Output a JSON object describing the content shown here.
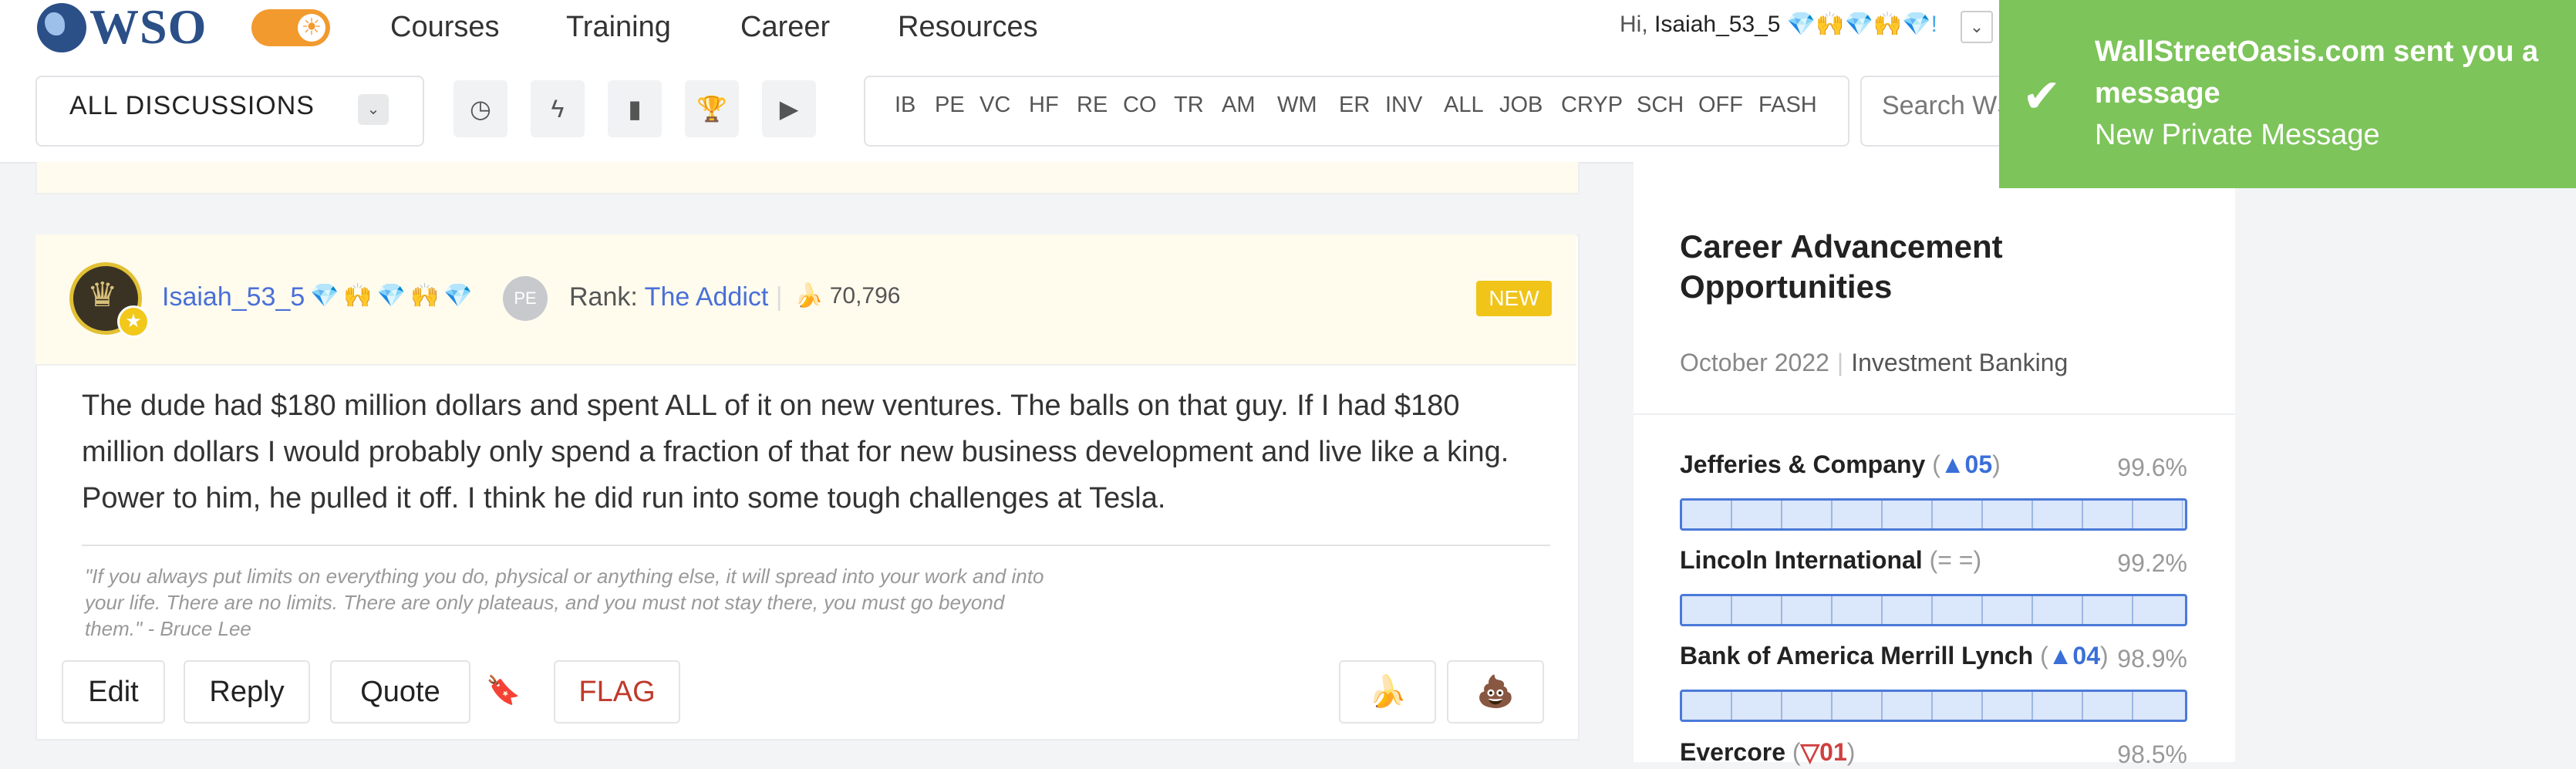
{
  "header": {
    "logo_text": "WSO",
    "nav": [
      "Courses",
      "Training",
      "Career",
      "Resources"
    ],
    "greeting_prefix": "Hi,",
    "greeting_user": "Isaiah_53_5",
    "greeting_emoji": "💎🙌💎🙌💎!"
  },
  "toolbar": {
    "discussions_label": "ALL DISCUSSIONS",
    "categories": [
      "IB",
      "PE",
      "VC",
      "HF",
      "RE",
      "CO",
      "TR",
      "AM",
      "WM",
      "ER",
      "INV",
      "ALL",
      "JOB",
      "CRYP",
      "SCH",
      "OFF",
      "FASH"
    ],
    "search_placeholder": "Search WSO"
  },
  "post": {
    "username": "Isaiah_53_5",
    "user_emoji": "💎🙌💎🙌💎",
    "pe_badge": "PE",
    "rank_label": "Rank:",
    "rank_value": "The Addict",
    "banana_count": "70,796",
    "new_badge": "NEW",
    "body": "The dude had $180 million dollars and spent ALL of it on new ventures. The balls on that guy. If I had $180 million dollars I would probably only spend a fraction of that for new business development and live like a king. Power to him, he pulled it off. I think he did run into some tough challenges at Tesla.",
    "signature": "\"If you always put limits on everything you do, physical or anything else, it will spread into your work and into your life. There are no limits. There are only plateaus, and you must not stay there, you must go beyond them.\" - Bruce Lee",
    "actions": {
      "edit": "Edit",
      "reply": "Reply",
      "quote": "Quote",
      "flag": "FLAG"
    }
  },
  "sidebar": {
    "title": "Career Advancement Opportunities",
    "date": "October 2022",
    "field": "Investment Banking",
    "banks": [
      {
        "name": "Jefferies & Company",
        "change": "▲05",
        "dir": "up",
        "pct": "99.6%",
        "level": 0.996
      },
      {
        "name": "Lincoln International",
        "change": "= =",
        "dir": "same",
        "pct": "99.2%",
        "level": 0.992
      },
      {
        "name": "Bank of America Merrill Lynch",
        "change": "▲04",
        "dir": "up",
        "pct": "98.9%",
        "level": 0.989
      },
      {
        "name": "Evercore",
        "change": "▽01",
        "dir": "down",
        "pct": "98.5%",
        "level": 0.985
      }
    ]
  },
  "notification": {
    "title": "WallStreetOasis.com sent you a message",
    "message": "New Private Message"
  },
  "colors": {
    "brand": "#2b4f87",
    "accent": "#f29a2e",
    "link": "#4a6fd8",
    "toast": "#7dc45a",
    "flag": "#c0392b"
  }
}
